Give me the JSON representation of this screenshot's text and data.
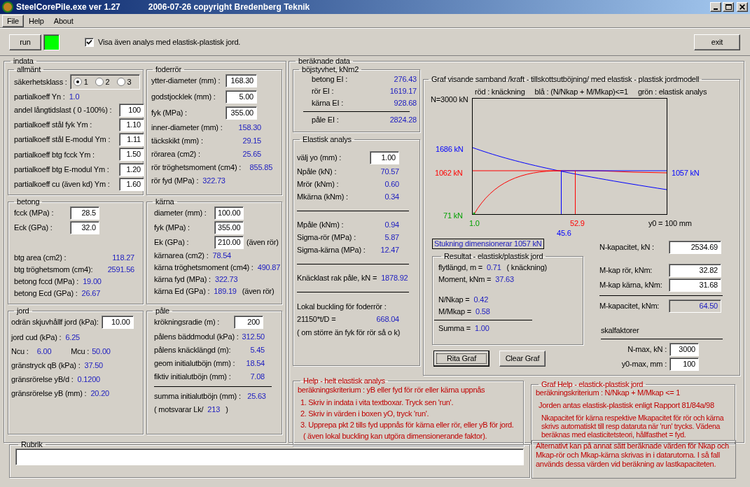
{
  "window": {
    "title": "SteelCorePile.exe  ver 1.27",
    "subtitle": "2006-07-26 copyright Bredenberg Teknik"
  },
  "menu": [
    {
      "label": "File",
      "selected": true
    },
    {
      "label": "Help",
      "selected": false
    },
    {
      "label": "About",
      "selected": false
    }
  ],
  "toolbar": {
    "run_button": "run",
    "status_light": {
      "color": "#00ff00"
    },
    "checkbox": {
      "label": "Visa även analys med elastisk-plastisk jord.",
      "checked": true
    },
    "exit_button": "exit"
  },
  "indata": {
    "title": "indata",
    "sections": [
      {
        "title": "allmänt",
        "rows": [
          {
            "kind": "radio",
            "label": "säkerhetsklass :",
            "options": [
              {
                "label": "1",
                "selected": true
              },
              {
                "label": "2",
                "selected": false
              },
              {
                "label": "3",
                "selected": false
              }
            ]
          },
          {
            "kind": "inline",
            "label": "partialkoeff Yn :",
            "value": "1.0"
          },
          {
            "kind": "input",
            "label": "andel långtidslast ( 0 -100%) :",
            "value": "100"
          },
          {
            "kind": "input",
            "label": "partialkoeff stål fyk Ym :",
            "value": "1.10"
          },
          {
            "kind": "input",
            "label": "partialkoeff stål E-modul Ym :",
            "value": "1.11"
          },
          {
            "kind": "input",
            "label": "partialkoeff btg fcck Ym :",
            "value": "1.50"
          },
          {
            "kind": "input",
            "label": "partialkoeff btg E-modul Ym :",
            "value": "1.20"
          },
          {
            "kind": "input",
            "label": "partialkoeff cu (även kd) Ym :",
            "value": "1.60"
          }
        ]
      },
      {
        "title": "foderrör",
        "rows": [
          {
            "kind": "input",
            "label": "ytter-diameter (mm) :",
            "value": "168.30"
          },
          {
            "kind": "input",
            "label": "godstjocklek  (mm) :",
            "value": "5.00"
          },
          {
            "kind": "input",
            "label": "fyk (MPa)  :",
            "value": "355.00"
          },
          {
            "kind": "output",
            "label": "inner-diameter (mm) :",
            "value": "158.30"
          },
          {
            "kind": "output",
            "label": "täckskikt  (mm) :",
            "value": "29.15"
          },
          {
            "kind": "output",
            "label": "rörarea (cm2) :",
            "value": "25.65"
          },
          {
            "kind": "output",
            "label": "rör tröghetsmoment (cm4) :",
            "value": "855.85"
          },
          {
            "kind": "inline",
            "label": "rör fyd (MPa) :",
            "value": "322.73"
          }
        ]
      },
      {
        "title": "betong",
        "rows": [
          {
            "kind": "input",
            "label": "fcck (MPa) :",
            "value": "28.5"
          },
          {
            "kind": "input",
            "label": "Eck (GPa) :",
            "value": "32.0"
          },
          {
            "kind": "output",
            "label": "btg area (cm2) :",
            "value": "118.27"
          },
          {
            "kind": "output",
            "label": "btg tröghetsmom (cm4):",
            "value": "2591.56"
          },
          {
            "kind": "inline",
            "label": "betong fccd (MPa) :",
            "value": "19.00"
          },
          {
            "kind": "inline",
            "label": "betong Ecd  (GPa) :",
            "value": "26.67"
          }
        ]
      },
      {
        "title": "kärna",
        "rows": [
          {
            "kind": "input",
            "label": "diameter (mm) :",
            "value": "100.00"
          },
          {
            "kind": "input",
            "label": "fyk (MPa) :",
            "value": "355.00"
          },
          {
            "kind": "input",
            "label": "Ek (GPa) :",
            "value": "210.00",
            "suffix": "(även rör)"
          },
          {
            "kind": "inline",
            "label": "kärnarea (cm2) :",
            "value": "78.54"
          },
          {
            "kind": "inline",
            "label": "kärna tröghetsmoment (cm4) :",
            "value": "490.87"
          },
          {
            "kind": "inline",
            "label": "kärna fyd (MPa) :",
            "value": "322.73"
          },
          {
            "kind": "inline",
            "label": "kärna Ed (GPa) :",
            "value": "189.19",
            "suffix": "(även rör)"
          }
        ]
      },
      {
        "title": "jord",
        "rows": [
          {
            "kind": "input",
            "label": "odrän skjuvhållf jord (kPa):",
            "value": "10.00"
          },
          {
            "kind": "inline",
            "label": "jord cud (kPa) :",
            "value": "6.25"
          },
          {
            "kind": "pair",
            "label": "Ncu :",
            "value": "6.00",
            "label2": "Mcu :",
            "value2": "50.00"
          },
          {
            "kind": "inline",
            "label": "gränstryck qB (kPa) :",
            "value": "37.50"
          },
          {
            "kind": "inline",
            "label": "gränsrörelse yB/d   :",
            "value": "0.1200"
          },
          {
            "kind": "inline",
            "label": "gränsrörelse yB (mm)  :",
            "value": "20.20"
          }
        ]
      },
      {
        "title": "påle",
        "rows": [
          {
            "kind": "input",
            "label": "krökningsradie (m) :",
            "value": "200"
          },
          {
            "kind": "output",
            "label": "pålens bäddmodul (kPa) :",
            "value": "312.50"
          },
          {
            "kind": "output",
            "label": "pålens knäcklängd (m):",
            "value": "5.45"
          },
          {
            "kind": "output",
            "label": "geom initialutböjn (mm) :",
            "value": "18.54"
          },
          {
            "kind": "output",
            "label": "fiktiv initialutböjn (mm) :",
            "value": "7.08"
          },
          {
            "kind": "rule"
          },
          {
            "kind": "output",
            "label": "summa initialutböjn (mm) :",
            "value": "25.63"
          },
          {
            "kind": "inline",
            "label": "( motsvarar Lk/",
            "value": "213",
            "suffix": ")"
          }
        ]
      }
    ]
  },
  "results": {
    "title": "beräknade data",
    "sections": [
      {
        "title": "böjstyvhet, kNm2",
        "rows": [
          {
            "kind": "output",
            "label": "betong EI  :",
            "value": "276.43"
          },
          {
            "kind": "output",
            "label": "rör EI       :",
            "value": "1619.17"
          },
          {
            "kind": "output",
            "label": "kärna EI  :",
            "value": "928.68"
          },
          {
            "kind": "rule"
          },
          {
            "kind": "output",
            "label": "påle EI   :",
            "value": "2824.28"
          }
        ]
      },
      {
        "title": "Elastisk analys",
        "rows": [
          {
            "kind": "input",
            "label": "välj yo  (mm) :",
            "value": "1.00"
          },
          {
            "kind": "output",
            "label": "Npåle (kN) :",
            "value": "70.57"
          },
          {
            "kind": "output",
            "label": "Mrör (kNm) :",
            "value": "0.60"
          },
          {
            "kind": "output",
            "label": "Mkärna (kNm) :",
            "value": "0.34"
          },
          {
            "kind": "rule"
          },
          {
            "kind": "output",
            "label": "Mpåle (kNm) :",
            "value": "0.94"
          },
          {
            "kind": "output",
            "label": "Sigma-rör (MPa) :",
            "value": "5.87"
          },
          {
            "kind": "output",
            "label": "Sigma-kärna (MPa) :",
            "value": "12.47"
          },
          {
            "kind": "rule"
          },
          {
            "kind": "inline",
            "label": "Knäcklast rak påle, kN =",
            "value": "1878.92"
          },
          {
            "kind": "rule"
          },
          {
            "kind": "text",
            "label": "Lokal buckling för foderrör :"
          },
          {
            "kind": "output",
            "label": "21150*t/D  =",
            "value": "668.04"
          },
          {
            "kind": "text",
            "label": "( om större än fyk för rör så o k)"
          }
        ]
      }
    ],
    "graph": {
      "title": "Graf visande samband /kraft - tillskottsutböjning/ med elastisk - plastisk jordmodell",
      "legend": [
        "röd : knäckning",
        "blå :  (N/Nkap + M/Mkap)<=1",
        "grön : elastisk analys"
      ],
      "labels": [
        {
          "kind": "y_max",
          "text": "N=3000 kN"
        },
        {
          "kind": "y_start",
          "text": "1686 kN"
        },
        {
          "kind": "y_limit",
          "text": "1062 kN"
        },
        {
          "kind": "y_end",
          "text": "1057 kN"
        },
        {
          "kind": "y_green",
          "text": "71 kN"
        },
        {
          "kind": "x_start",
          "text": "1.0"
        },
        {
          "kind": "x_red",
          "text": "52.9"
        },
        {
          "kind": "x_blue",
          "text": "45.6"
        },
        {
          "kind": "x_max",
          "text": "y0 = 100 mm"
        }
      ],
      "verdict": "Stukning dimensionerar 1057 kN",
      "result": {
        "title": "Resultat - elastisk/plastisk jord",
        "rows": [
          {
            "kind": "inline",
            "label": "flytlängd, m =",
            "value": "0.71",
            "suffix": "( knäckning)"
          },
          {
            "kind": "inline",
            "label": "Moment, kNm =",
            "value": "37.63"
          },
          {
            "kind": "inline",
            "label": "N/Nkap  =",
            "value": "0.42"
          },
          {
            "kind": "inline",
            "label": "M/Mkap  =",
            "value": "0.58"
          },
          {
            "kind": "rule"
          },
          {
            "kind": "inline",
            "label": "Summa  =",
            "value": "1.00"
          }
        ]
      },
      "buttons": [
        {
          "label": "Rita Graf",
          "focused": true
        },
        {
          "label": "Clear Graf",
          "focused": false
        }
      ],
      "capacity": [
        {
          "kind": "input",
          "label": "N-kapacitet, kN  :",
          "value": "2534.69"
        },
        {
          "kind": "input",
          "label": "M-kap rör,     kNm:",
          "value": "32.82"
        },
        {
          "kind": "input",
          "label": "M-kap kärna, kNm:",
          "value": "31.68"
        },
        {
          "kind": "rule"
        },
        {
          "kind": "readonly",
          "label": "M-kapacitet, kNm:",
          "value": "64.50"
        }
      ],
      "scale": {
        "title": "skalfaktorer",
        "rows": [
          {
            "kind": "input",
            "label": "N-max, kN  :",
            "value": "3000"
          },
          {
            "kind": "input",
            "label": "y0-max, mm  :",
            "value": "100"
          }
        ]
      }
    },
    "help": {
      "title": "Help - helt elastisk analys",
      "lines": [
        "beräkningskriterium : yB eller fyd för rör eller kärna uppnås",
        "1. Skriv in indata i vita textboxar. Tryck sen 'run'.",
        "2. Skriv in värden i boxen yO, tryck 'run'.",
        "3. Upprepa pkt 2 tills fyd uppnås för kärna eller rör, eller yB för jord.",
        "( även lokal buckling kan utgöra dimensionerande faktor)."
      ]
    },
    "graph_help": {
      "title": "Graf Help - elastick-plastisk jord",
      "lines": [
        "beräkningskriterium : N/Nkap + M/Mkap <= 1",
        "Jorden antas elastisk-plastisk enligt Rapport 81/84a/98",
        "Nkapacitet för kärna respektive Mkapacitet för rör och kärna skrivs automatiskt till resp dataruta när 'run' trycks. Vädena beräknas med elasticitetsteori, hållfasthet = fyd."
      ]
    }
  },
  "rubrik": {
    "title": "Rubrik"
  },
  "alternative_note": "Alternativt kan på annat sätt beräknade värden för Nkap och Mkap-rör och Mkap-kärna skrivas in i datarutorna. I så fall används dessa värden vid beräkning av lastkapaciteten."
}
